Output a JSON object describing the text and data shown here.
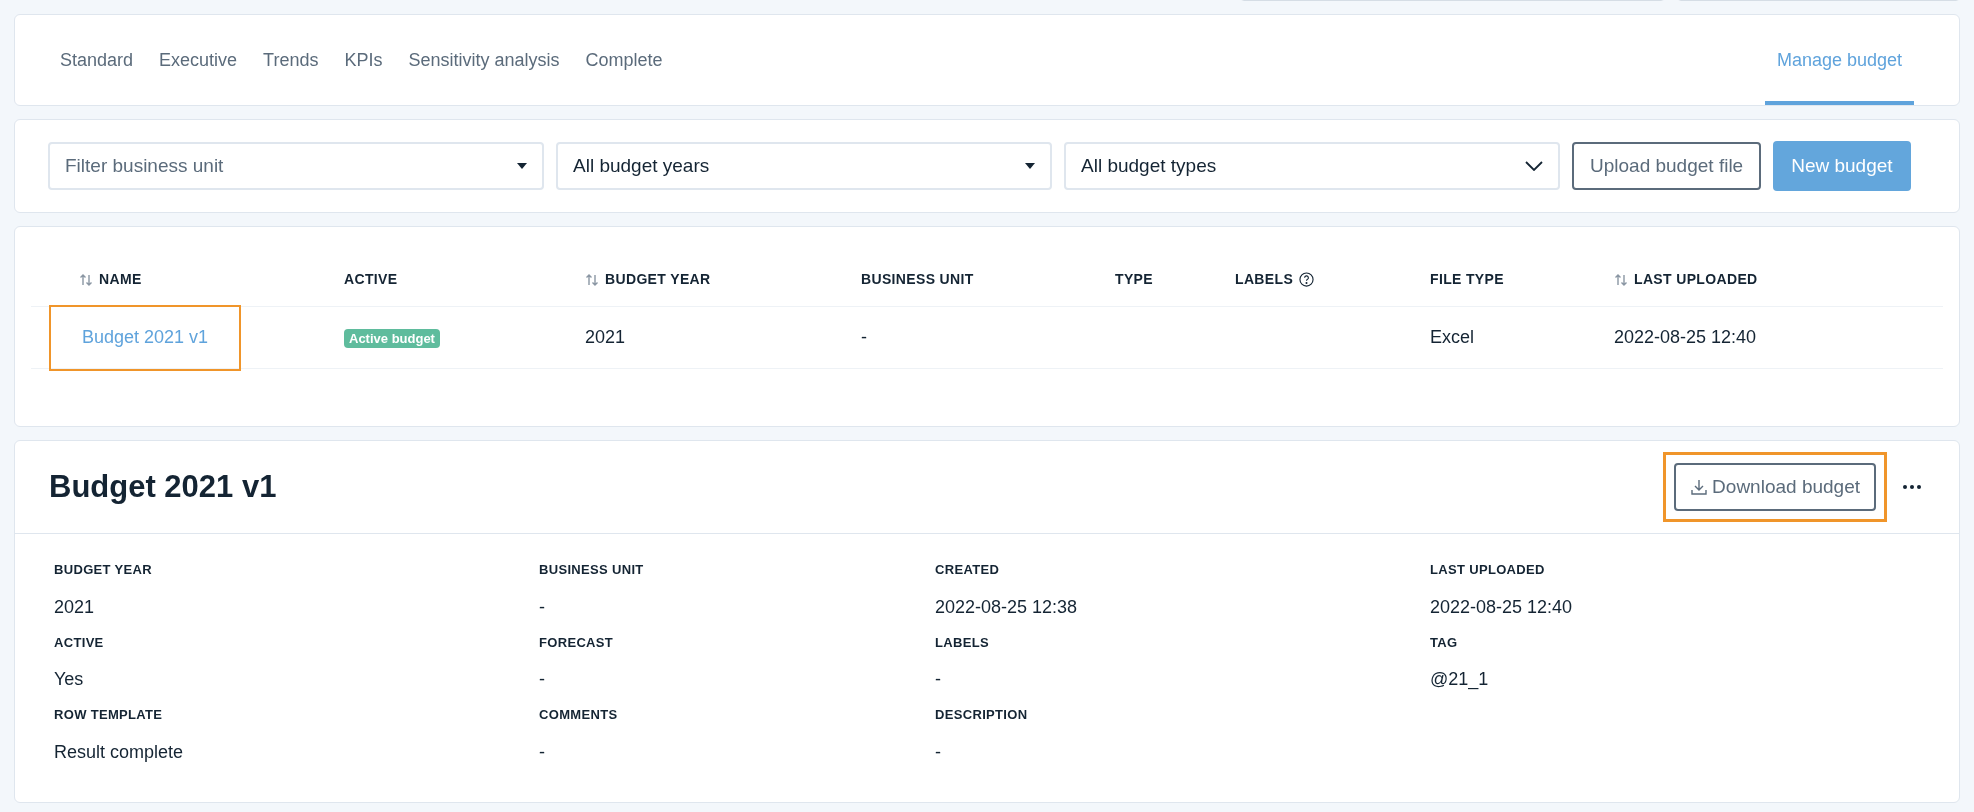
{
  "tabs": [
    {
      "label": "Standard",
      "selected": false
    },
    {
      "label": "Executive",
      "selected": false
    },
    {
      "label": "Trends",
      "selected": false
    },
    {
      "label": "KPIs",
      "selected": false
    },
    {
      "label": "Sensitivity analysis",
      "selected": false
    },
    {
      "label": "Complete",
      "selected": false
    }
  ],
  "manage_tab": {
    "label": "Manage budget",
    "selected": true
  },
  "filters": [
    {
      "kind": "small-caret",
      "placeholder": "Filter business unit"
    },
    {
      "kind": "small-caret",
      "value": "All budget years"
    },
    {
      "kind": "chevron",
      "value": "All budget types"
    }
  ],
  "upload_button": "Upload budget file",
  "new_button": "New budget",
  "table": {
    "columns": [
      {
        "label": "NAME",
        "sortable": true
      },
      {
        "label": "ACTIVE",
        "sortable": false
      },
      {
        "label": "BUDGET YEAR",
        "sortable": true
      },
      {
        "label": "BUSINESS UNIT",
        "sortable": false
      },
      {
        "label": "TYPE",
        "sortable": false
      },
      {
        "label": "LABELS",
        "sortable": false,
        "help": true
      },
      {
        "label": "FILE TYPE",
        "sortable": false
      },
      {
        "label": "LAST UPLOADED",
        "sortable": true
      }
    ],
    "rows": [
      {
        "name": "Budget 2021 v1",
        "highlighted": true,
        "active_badge": "Active budget",
        "budget_year": "2021",
        "business_unit": "-",
        "type": "",
        "labels": "",
        "file_type": "Excel",
        "last_uploaded": "2022-08-25 12:40"
      }
    ]
  },
  "detail": {
    "title": "Budget 2021 v1",
    "download_button": "Download budget",
    "download_highlighted": true,
    "fields": [
      {
        "label": "BUDGET YEAR",
        "value": "2021"
      },
      {
        "label": "BUSINESS UNIT",
        "value": "-"
      },
      {
        "label": "CREATED",
        "value": "2022-08-25 12:38"
      },
      {
        "label": "LAST UPLOADED",
        "value": "2022-08-25 12:40"
      },
      {
        "label": "ACTIVE",
        "value": "Yes"
      },
      {
        "label": "FORECAST",
        "value": "-"
      },
      {
        "label": "LABELS",
        "value": "-"
      },
      {
        "label": "TAG",
        "value": "@21_1"
      },
      {
        "label": "ROW TEMPLATE",
        "value": "Result complete"
      },
      {
        "label": "COMMENTS",
        "value": "-"
      },
      {
        "label": "DESCRIPTION",
        "value": "-"
      }
    ]
  }
}
